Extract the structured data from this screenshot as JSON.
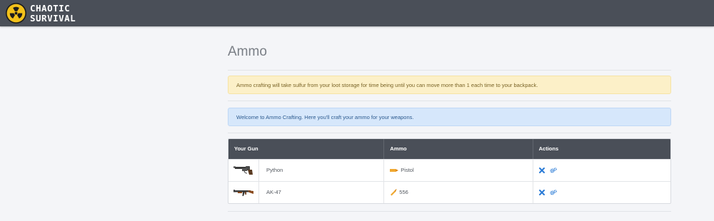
{
  "header": {
    "logo_line1": "CHAOTIC",
    "logo_line2": "SURVIVAL",
    "logo_icon": "radiation-icon"
  },
  "page": {
    "title": "Ammo"
  },
  "alerts": {
    "warning": "Ammo crafting will take sulfur from your loot storage for time being until you can move more than 1 each time to your backpack.",
    "info": "Welcome to Ammo Crafting. Here you'll craft your ammo for your weapons."
  },
  "table": {
    "headers": [
      "Your Gun",
      "Ammo",
      "Actions"
    ],
    "rows": [
      {
        "gun": "Python",
        "gun_icon": "revolver-icon",
        "ammo": "Pistol",
        "ammo_icon": "pistol-bullet-icon"
      },
      {
        "gun": "AK-47",
        "gun_icon": "rifle-icon",
        "ammo": "556",
        "ammo_icon": "rifle-bullet-icon"
      }
    ],
    "action_icons": [
      "close-icon",
      "gears-icon"
    ]
  },
  "colors": {
    "topbar": "#4a4f58",
    "accent_blue": "#2a7bd6",
    "warning_bg": "#fcf0c8",
    "info_bg": "#d6e7fb"
  }
}
